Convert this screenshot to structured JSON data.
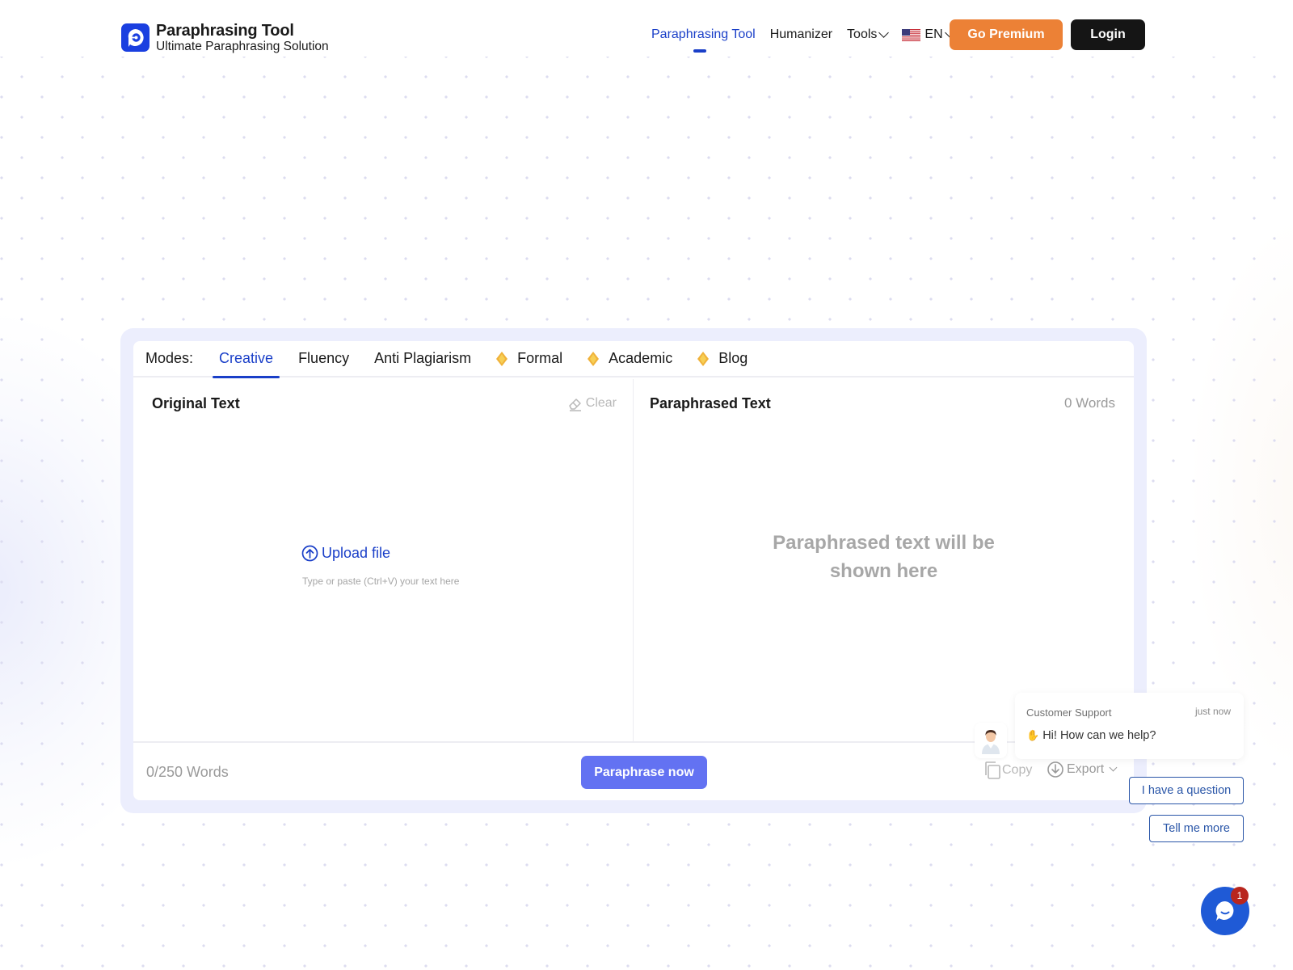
{
  "header": {
    "logo_title": "Paraphrasing Tool",
    "logo_subtitle": "Ultimate Paraphrasing Solution",
    "nav": [
      {
        "label": "Paraphrasing Tool",
        "active": true
      },
      {
        "label": "Humanizer"
      },
      {
        "label": "Tools"
      },
      {
        "label": "EN"
      }
    ],
    "premium_label": "Go Premium",
    "login_label": "Login",
    "accent_color": "#1a3fc8",
    "premium_color": "#ec8136"
  },
  "editor": {
    "modes_label": "Modes:",
    "modes": [
      {
        "label": "Creative",
        "active": true,
        "premium": false
      },
      {
        "label": "Fluency",
        "premium": false
      },
      {
        "label": "Anti Plagiarism",
        "premium": false
      },
      {
        "label": "Formal",
        "premium": true
      },
      {
        "label": "Academic",
        "premium": true
      },
      {
        "label": "Blog",
        "premium": true
      }
    ],
    "input": {
      "title": "Original Text",
      "clear_label": "Clear",
      "upload_label": "Upload file",
      "placeholder": "Type or paste (Ctrl+V) your text here",
      "word_limit": "0/250 Words"
    },
    "output": {
      "title": "Paraphrased Text",
      "word_count": "0 Words",
      "placeholder_line1": "Paraphrased text will be",
      "placeholder_line2": "shown here",
      "copy_label": "Copy",
      "export_label": "Export"
    },
    "paraphrase_label": "Paraphrase now",
    "paraphrase_color": "#6372f2"
  },
  "chat": {
    "agent": "Customer Support",
    "time": "just now",
    "message": "Hi! How can we help?",
    "quick_replies": [
      "I have a question",
      "Tell me more"
    ],
    "unread_count": "1"
  }
}
